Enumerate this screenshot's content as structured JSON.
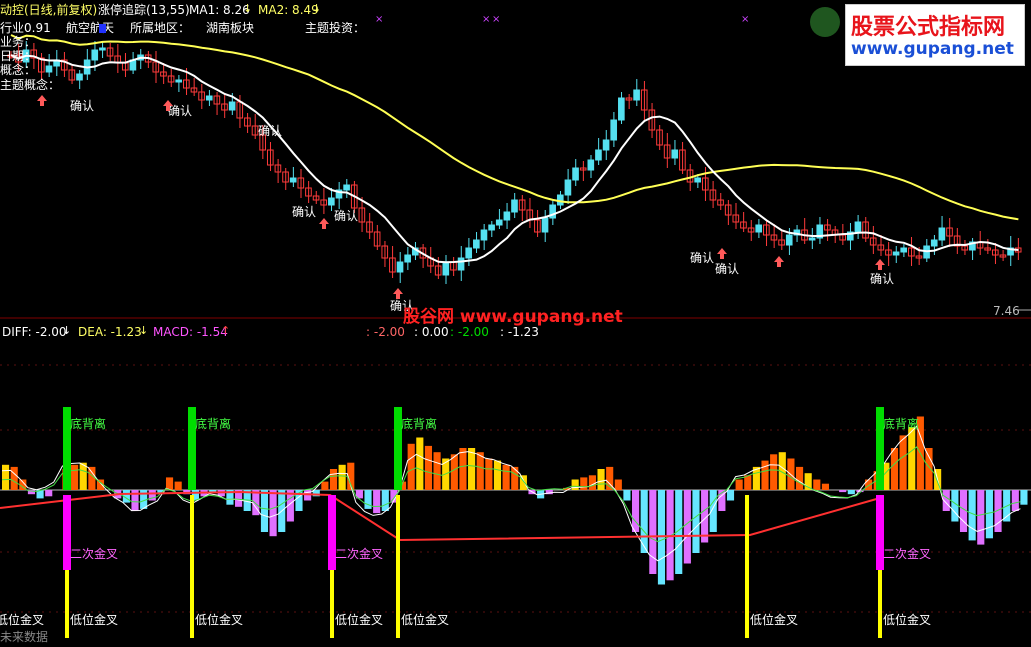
{
  "header": {
    "title": "动控(日线,前复权)",
    "indicator": "涨停追踪(13,55)",
    "ma1_label": "MA1: 8.26",
    "ma2_label": "MA2: 8.49"
  },
  "info": {
    "industry_prefix": "行业0.91",
    "industry_value": "航空航天",
    "region_label": "所属地区：",
    "region_value": "湖南板块",
    "theme_label": "主题投资：",
    "business_label": "业务：",
    "period_label": "日期：",
    "concept_label": "概念：",
    "theme_concept_label": "主题概念："
  },
  "watermark": {
    "title": "股票公式指标网",
    "url": "www.gupang.net",
    "center_text": "股谷网  www.gupang.net"
  },
  "price_label": "7.46",
  "macd_header": {
    "diff": "DIFF: -2.00",
    "dea": "DEA: -1.23",
    "macd": "MACD: -1.54",
    "v1": ": -2.00",
    "v2": ": 0.00",
    "v3": ": -2.00",
    "v4": ": -1.23"
  },
  "labels": {
    "confirm": "确认",
    "bottom_divergence": "底背离",
    "second_golden_cross": "二次金叉",
    "low_golden_cross": "低位金叉",
    "future_data": "未来数据"
  },
  "colors": {
    "up": "#ff3b3b",
    "down": "#55e0f0",
    "ma1": "#ffffff",
    "ma2": "#ffff55",
    "hist_pos_a": "#ff5a00",
    "hist_pos_b": "#ffd700",
    "hist_neg_a": "#66e6ff",
    "hist_neg_b": "#e070ff",
    "signal_green": "#00dd00",
    "signal_yellow": "#ffff00",
    "signal_magenta": "#ff00ff"
  },
  "chart_data": [
    {
      "type": "candlestick",
      "title": "涨停追踪(13,55)",
      "series": [
        {
          "name": "MA1",
          "values_note": "white moving average"
        },
        {
          "name": "MA2",
          "values_note": "yellow moving average"
        }
      ],
      "price_ticks": [
        7.46
      ]
    },
    {
      "type": "bar",
      "title": "MACD",
      "series": [
        {
          "name": "DIFF",
          "last": -2.0
        },
        {
          "name": "DEA",
          "last": -1.23
        },
        {
          "name": "MACD",
          "last": -1.54
        }
      ]
    }
  ]
}
